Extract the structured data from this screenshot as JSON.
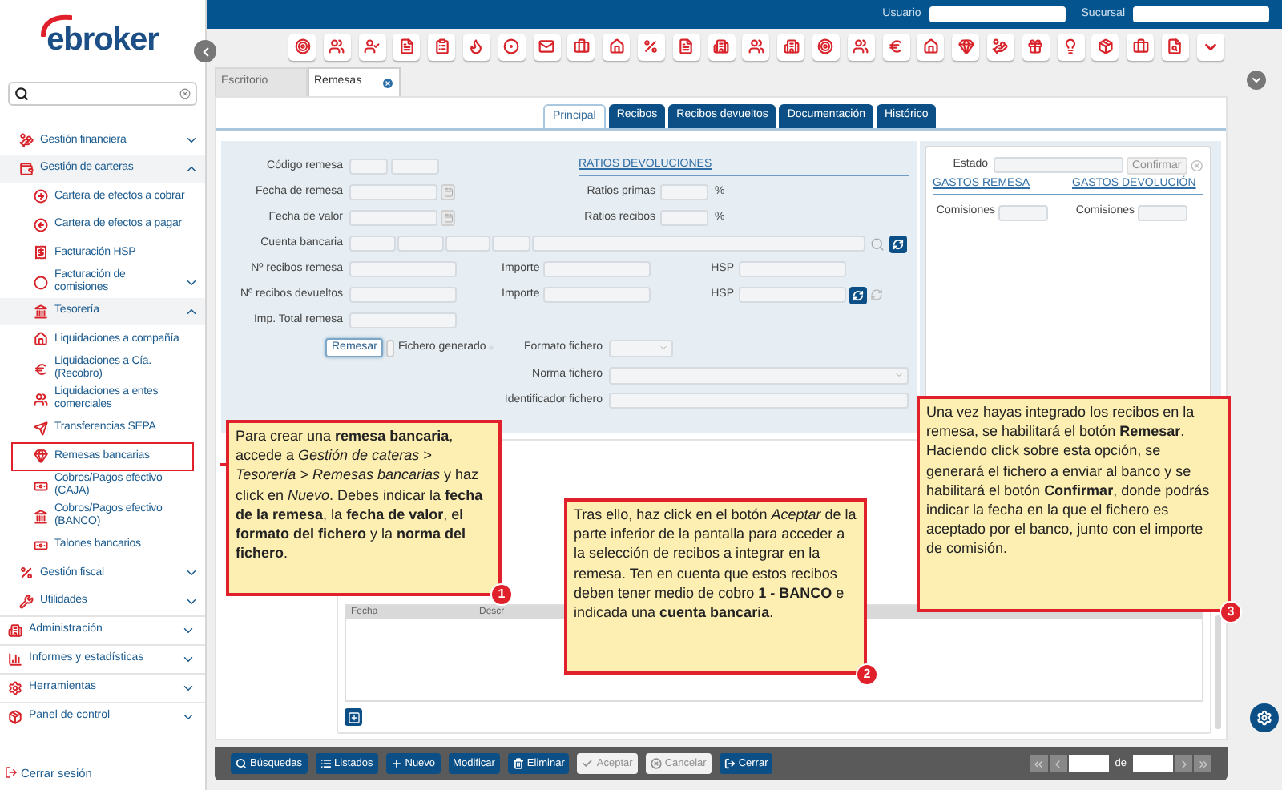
{
  "logo": "ebroker",
  "header": {
    "user_label": "Usuario",
    "branch_label": "Sucursal"
  },
  "tabs": [
    {
      "label": "Escritorio",
      "selected": false,
      "closable": false
    },
    {
      "label": "Remesas",
      "selected": true,
      "closable": true
    }
  ],
  "sidebar": {
    "menu": [
      {
        "label": "Gestión financiera",
        "expanded": false
      },
      {
        "label": "Gestión de carteras",
        "expanded": true,
        "children": [
          {
            "label": "Cartera de efectos a cobrar",
            "selected": false
          },
          {
            "label": "Cartera de efectos a pagar",
            "selected": false
          },
          {
            "label": "Facturación HSP",
            "selected": false
          },
          {
            "label": "Facturación de comisiones",
            "selected": false,
            "expanded": false
          },
          {
            "label": "Tesorería",
            "selected": false,
            "expanded": true,
            "children": [
              {
                "label": "Liquidaciones a compañía",
                "selected": false
              },
              {
                "label": "Liquidaciones a Cía. (Recobro)",
                "selected": false
              },
              {
                "label": "Liquidaciones a entes comerciales",
                "selected": false
              },
              {
                "label": "Transferencias SEPA",
                "selected": false
              },
              {
                "label": "Remesas bancarias",
                "selected": true
              },
              {
                "label": "Cobros/Pagos efectivo (CAJA)",
                "selected": false
              },
              {
                "label": "Cobros/Pagos efectivo (BANCO)",
                "selected": false
              },
              {
                "label": "Talones bancarios",
                "selected": false
              }
            ]
          }
        ]
      },
      {
        "label": "Gestión fiscal",
        "expanded": false
      },
      {
        "label": "Utilidades",
        "expanded": false
      }
    ],
    "sections": [
      {
        "label": "Administración",
        "expanded": false
      },
      {
        "label": "Informes y estadísticas",
        "expanded": false
      },
      {
        "label": "Herramientas",
        "expanded": false
      },
      {
        "label": "Panel de control",
        "expanded": false
      }
    ],
    "logout": "Cerrar sesión"
  },
  "subtabs": [
    {
      "label": "Principal",
      "selected": true
    },
    {
      "label": "Recibos",
      "selected": false
    },
    {
      "label": "Recibos devueltos",
      "selected": false
    },
    {
      "label": "Documentación",
      "selected": false
    },
    {
      "label": "Histórico",
      "selected": false
    }
  ],
  "form": {
    "codigo": "Código remesa",
    "fecha_remesa": "Fecha de remesa",
    "fecha_valor": "Fecha de valor",
    "cuenta": "Cuenta bancaria",
    "n_recibos": "Nº recibos remesa",
    "n_devueltos": "Nº recibos devueltos",
    "total": "Imp. Total remesa",
    "importe_1": "Importe",
    "importe_2": "Importe",
    "hsp_1": "HSP",
    "hsp_2": "HSP",
    "ratios_title": "RATIOS DEVOLUCIONES",
    "ratios_primas": "Ratios primas",
    "ratios_recibos": "Ratios recibos",
    "percent_1": "%",
    "percent_2": "%",
    "remesar": "Remesar",
    "generated_label": "Fichero generado",
    "generated": false,
    "formato": "Formato fichero",
    "norma": "Norma fichero",
    "identificador": "Identificador fichero"
  },
  "status_panel": {
    "estado": "Estado",
    "confirm": {
      "label": "Confirmar",
      "disabled": true
    },
    "gastos_remesa": "GASTOS REMESA",
    "gastos_devolucion": "GASTOS DEVOLUCIÓN",
    "comisiones_1": "Comisiones",
    "comisiones_2": "Comisiones"
  },
  "grid": {
    "columns": [
      "Fecha",
      "Descr"
    ]
  },
  "toolbar": [
    {
      "label": "Búsquedas",
      "disabled": false
    },
    {
      "label": "Listados",
      "disabled": false
    },
    {
      "label": "Nuevo",
      "disabled": false
    },
    {
      "label": "Modificar",
      "disabled": false
    },
    {
      "label": "Eliminar",
      "disabled": false
    },
    {
      "label": "Aceptar",
      "disabled": true
    },
    {
      "label": "Cancelar",
      "disabled": true
    },
    {
      "label": "Cerrar",
      "disabled": false
    }
  ],
  "pager": {
    "separator": "de"
  },
  "callouts": [
    {
      "number": "1",
      "text": "Para crear una **remesa bancaria**, accede a *Gestión de cateras > Tesorería > Remesas bancarias* y haz click en *Nuevo*. Debes indicar la **fecha de la remesa**, la **fecha de valor**, el **formato del fichero** y la **norma del fichero**."
    },
    {
      "number": "2",
      "text": "Tras ello, haz click en el botón *Aceptar* de la parte inferior de la pantalla para acceder a la selección de recibos a integrar en la remesa. Ten en cuenta que estos recibos deben tener medio de cobro **1 - BANCO** e indicada una **cuenta bancaria**."
    },
    {
      "number": "3",
      "text": "Una vez hayas integrado los recibos en la remesa, se habilitará el botón **Remesar**. Haciendo click sobre esta opción, se generará el fichero a enviar al banco y se habilitará el botón **Confirmar**, donde podrás indicar la fecha en la que el fichero es aceptado por el banco, junto con el importe de comisión."
    }
  ]
}
